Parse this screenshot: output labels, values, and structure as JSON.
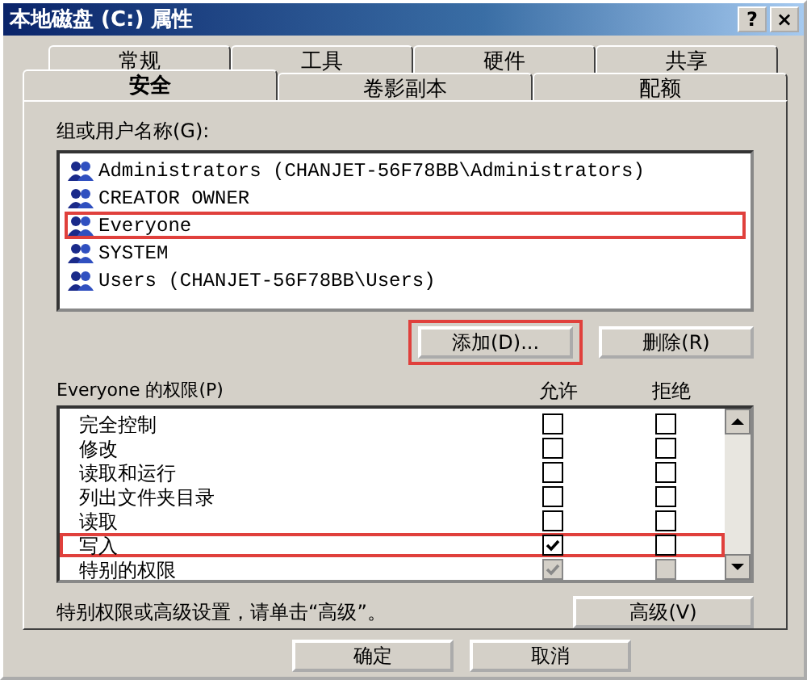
{
  "window": {
    "title": "本地磁盘 (C:) 属性",
    "buttons": [
      "?",
      "×"
    ]
  },
  "tab_rows": [
    [
      {
        "label": "常规",
        "selected": false
      },
      {
        "label": "工具",
        "selected": false
      },
      {
        "label": "硬件",
        "selected": false
      },
      {
        "label": "共享",
        "selected": false
      }
    ],
    [
      {
        "label": "安全",
        "selected": true
      },
      {
        "label": "卷影副本",
        "selected": false
      },
      {
        "label": "配额",
        "selected": false
      }
    ]
  ],
  "groups": {
    "label": "组或用户名称(G):",
    "items": [
      {
        "name": "Administrators (CHANJET-56F78BB\\Administrators)",
        "highlighted": false
      },
      {
        "name": "CREATOR OWNER",
        "highlighted": false
      },
      {
        "name": "Everyone",
        "highlighted": true
      },
      {
        "name": "SYSTEM",
        "highlighted": false
      },
      {
        "name": "Users (CHANJET-56F78BB\\Users)",
        "highlighted": false
      }
    ]
  },
  "group_buttons": [
    {
      "label": "添加(D)...",
      "highlighted": true
    },
    {
      "label": "删除(R)",
      "highlighted": false
    }
  ],
  "permissions": {
    "label": "Everyone 的权限(P)",
    "allow_header": "允许",
    "deny_header": "拒绝",
    "rows": [
      {
        "name": "完全控制",
        "allow_checked": false,
        "allow_disabled": false,
        "deny_checked": false,
        "deny_disabled": false,
        "highlighted": false
      },
      {
        "name": "修改",
        "allow_checked": false,
        "allow_disabled": false,
        "deny_checked": false,
        "deny_disabled": false,
        "highlighted": false
      },
      {
        "name": "读取和运行",
        "allow_checked": false,
        "allow_disabled": false,
        "deny_checked": false,
        "deny_disabled": false,
        "highlighted": false
      },
      {
        "name": "列出文件夹目录",
        "allow_checked": false,
        "allow_disabled": false,
        "deny_checked": false,
        "deny_disabled": false,
        "highlighted": false
      },
      {
        "name": "读取",
        "allow_checked": false,
        "allow_disabled": false,
        "deny_checked": false,
        "deny_disabled": false,
        "highlighted": false
      },
      {
        "name": "写入",
        "allow_checked": true,
        "allow_disabled": false,
        "deny_checked": false,
        "deny_disabled": false,
        "highlighted": true
      },
      {
        "name": "特别的权限",
        "allow_checked": true,
        "allow_disabled": true,
        "deny_checked": false,
        "deny_disabled": true,
        "highlighted": false
      }
    ]
  },
  "advanced": {
    "text": "特别权限或高级设置，请单击“高级”。",
    "button": "高级(V)"
  },
  "dialog_buttons": [
    "确定",
    "取消"
  ]
}
